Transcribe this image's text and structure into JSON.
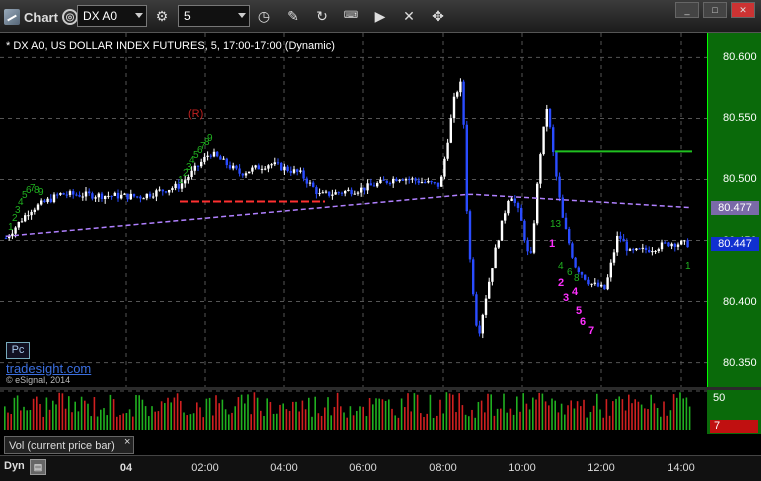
{
  "toolbar": {
    "title": "Chart",
    "symbol": "DX A0",
    "interval": "5",
    "icons": [
      "settings-icon",
      "clock-icon",
      "pencil-icon",
      "refresh-icon",
      "keyboard-icon",
      "play-icon",
      "cross-icon",
      "pin-icon"
    ]
  },
  "chart": {
    "title": "* DX A0, US DOLLAR INDEX FUTURES, 5, 17:00-17:00 (Dynamic)",
    "pc_label": "Pc",
    "brand": "tradesight.com",
    "copyright": "© eSignal, 2014",
    "vol_tab": "Vol (current price bar)",
    "vol_close": "×",
    "dyn_label": "Dyn",
    "r_marker": "(R)",
    "colors": {
      "up": "#ffffff",
      "down": "#2a4cff",
      "red_line": "#ff3030",
      "green_line": "#20c020",
      "purple": "#b080ff",
      "magenta": "#ff30ff",
      "green_count": "#20b020"
    }
  },
  "chart_data": {
    "type": "candlestick",
    "y_ticks": [
      "80.600",
      "80.550",
      "80.500",
      "80.450",
      "80.400",
      "80.350"
    ],
    "ylim": [
      80.33,
      80.62
    ],
    "x_ticks": [
      "04",
      "02:00",
      "04:00",
      "06:00",
      "08:00",
      "10:00",
      "12:00",
      "14:00"
    ],
    "last_price": "80.447",
    "ma_value": "80.477",
    "vol_axis": [
      "50",
      "7"
    ],
    "counts_green": [
      "1",
      "2",
      "3",
      "4",
      "5",
      "6",
      "7",
      "8",
      "9",
      "1",
      "2",
      "3",
      "4",
      "5",
      "6",
      "7",
      "8",
      "9",
      "13",
      "4",
      "6",
      "8",
      "1"
    ],
    "counts_magenta": [
      "1",
      "2",
      "3",
      "4",
      "5",
      "6",
      "7"
    ],
    "resistance_green": 80.523,
    "support_red": 80.482
  }
}
